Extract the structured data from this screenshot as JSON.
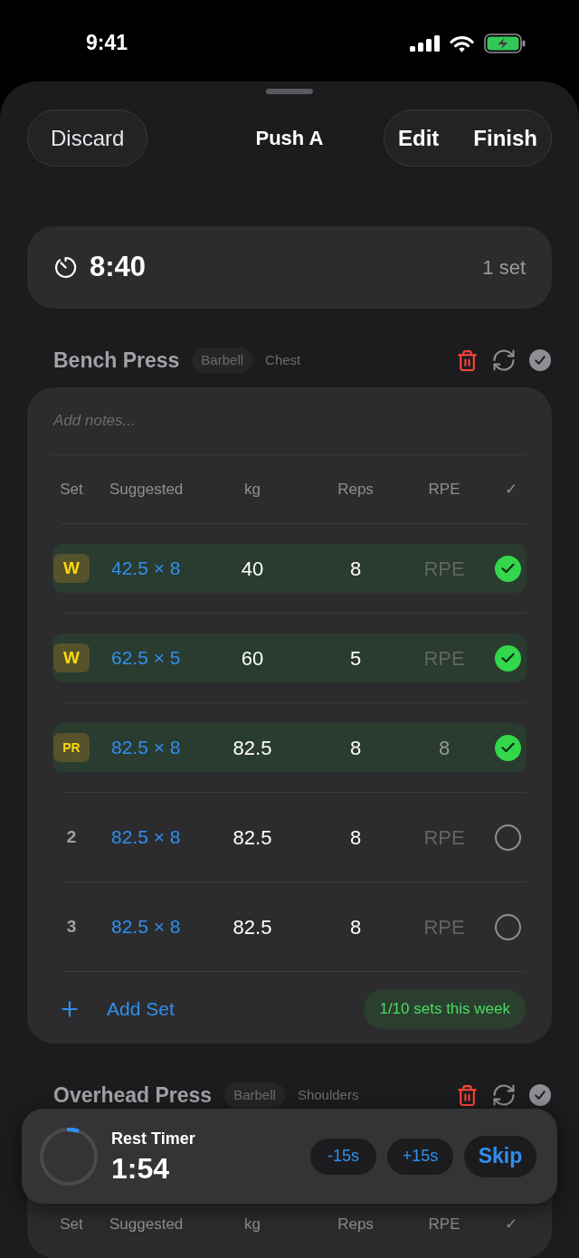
{
  "status_bar": {
    "time": "9:41"
  },
  "header": {
    "left_button": "Discard",
    "title": "Push A",
    "right_buttons": [
      "Edit",
      "Finish"
    ]
  },
  "workout_timer": {
    "elapsed": "8:40",
    "summary": "1 set"
  },
  "exercises": [
    {
      "name": "Bench Press",
      "tags": [
        {
          "label": "Barbell",
          "kind": "equipment"
        },
        {
          "label": "Chest",
          "kind": "muscle"
        }
      ],
      "notes": {
        "placeholder": "Add notes..."
      },
      "columns": [
        "Set",
        "Suggested",
        "kg",
        "Reps",
        "RPE",
        "✓"
      ],
      "sets": [
        {
          "kind": "warmup",
          "label": "W",
          "suggested": "42.5 × 8",
          "kg": "40",
          "reps": "8",
          "rpe": {
            "placeholder": "RPE"
          },
          "completed": true
        },
        {
          "kind": "warmup",
          "label": "W",
          "suggested": "62.5 × 5",
          "kg": "60",
          "reps": "5",
          "rpe": {
            "placeholder": "RPE"
          },
          "completed": true
        },
        {
          "kind": "pr",
          "label": "PR",
          "suggested": "82.5 × 8",
          "kg": "82.5",
          "reps": "8",
          "rpe": {
            "value": "8"
          },
          "completed": true
        },
        {
          "kind": "normal",
          "label": "2",
          "suggested": "82.5 × 8",
          "kg": "82.5",
          "reps": "8",
          "rpe": {
            "placeholder": "RPE"
          },
          "completed": false
        },
        {
          "kind": "normal",
          "label": "3",
          "suggested": "82.5 × 8",
          "kg": "82.5",
          "reps": "8",
          "rpe": {
            "placeholder": "RPE"
          },
          "completed": false
        }
      ],
      "add_set": "Add Set",
      "weekly_progress": "1/10 sets this week"
    },
    {
      "name": "Overhead Press",
      "tags": [
        {
          "label": "Barbell",
          "kind": "equipment"
        },
        {
          "label": "Shoulders",
          "kind": "muscle"
        }
      ],
      "columns": [
        "Set",
        "Suggested",
        "kg",
        "Reps",
        "RPE",
        "✓"
      ]
    }
  ],
  "rest_timer": {
    "label": "Rest Timer",
    "remaining": "1:54",
    "level": 0.05,
    "buttons": [
      {
        "label": "-15s",
        "kind": "adjust"
      },
      {
        "label": "+15s",
        "kind": "adjust"
      },
      {
        "label": "Skip",
        "kind": "primary"
      }
    ]
  }
}
